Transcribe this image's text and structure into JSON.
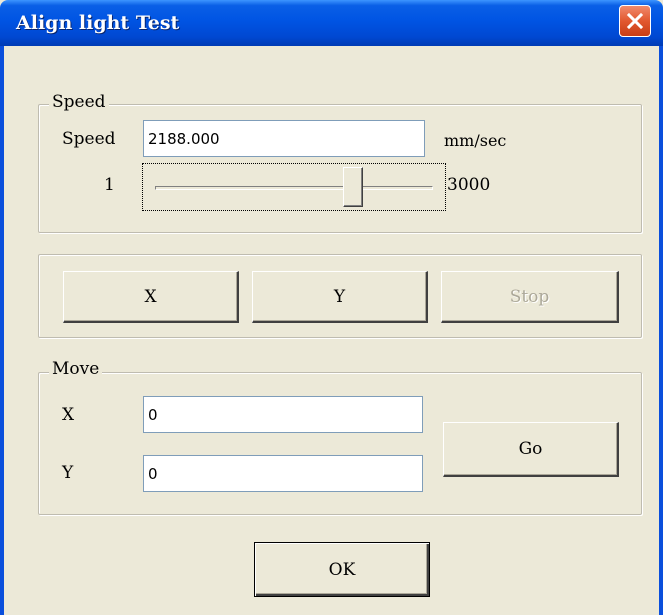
{
  "window": {
    "title": "Align light Test",
    "close_icon": "close-icon"
  },
  "speed_group": {
    "legend": "Speed",
    "speed_label": "Speed",
    "speed_value": "2188.000",
    "unit": "mm/sec",
    "slider_min_label": "1",
    "slider_max_label": "3000",
    "slider_min": 1,
    "slider_max": 3000,
    "slider_value": 2188
  },
  "axis_buttons": {
    "x_label": "X",
    "y_label": "Y",
    "stop_label": "Stop"
  },
  "move_group": {
    "legend": "Move",
    "x_label": "X",
    "x_value": "0",
    "y_label": "Y",
    "y_value": "0",
    "go_label": "Go"
  },
  "footer": {
    "ok_label": "OK"
  }
}
